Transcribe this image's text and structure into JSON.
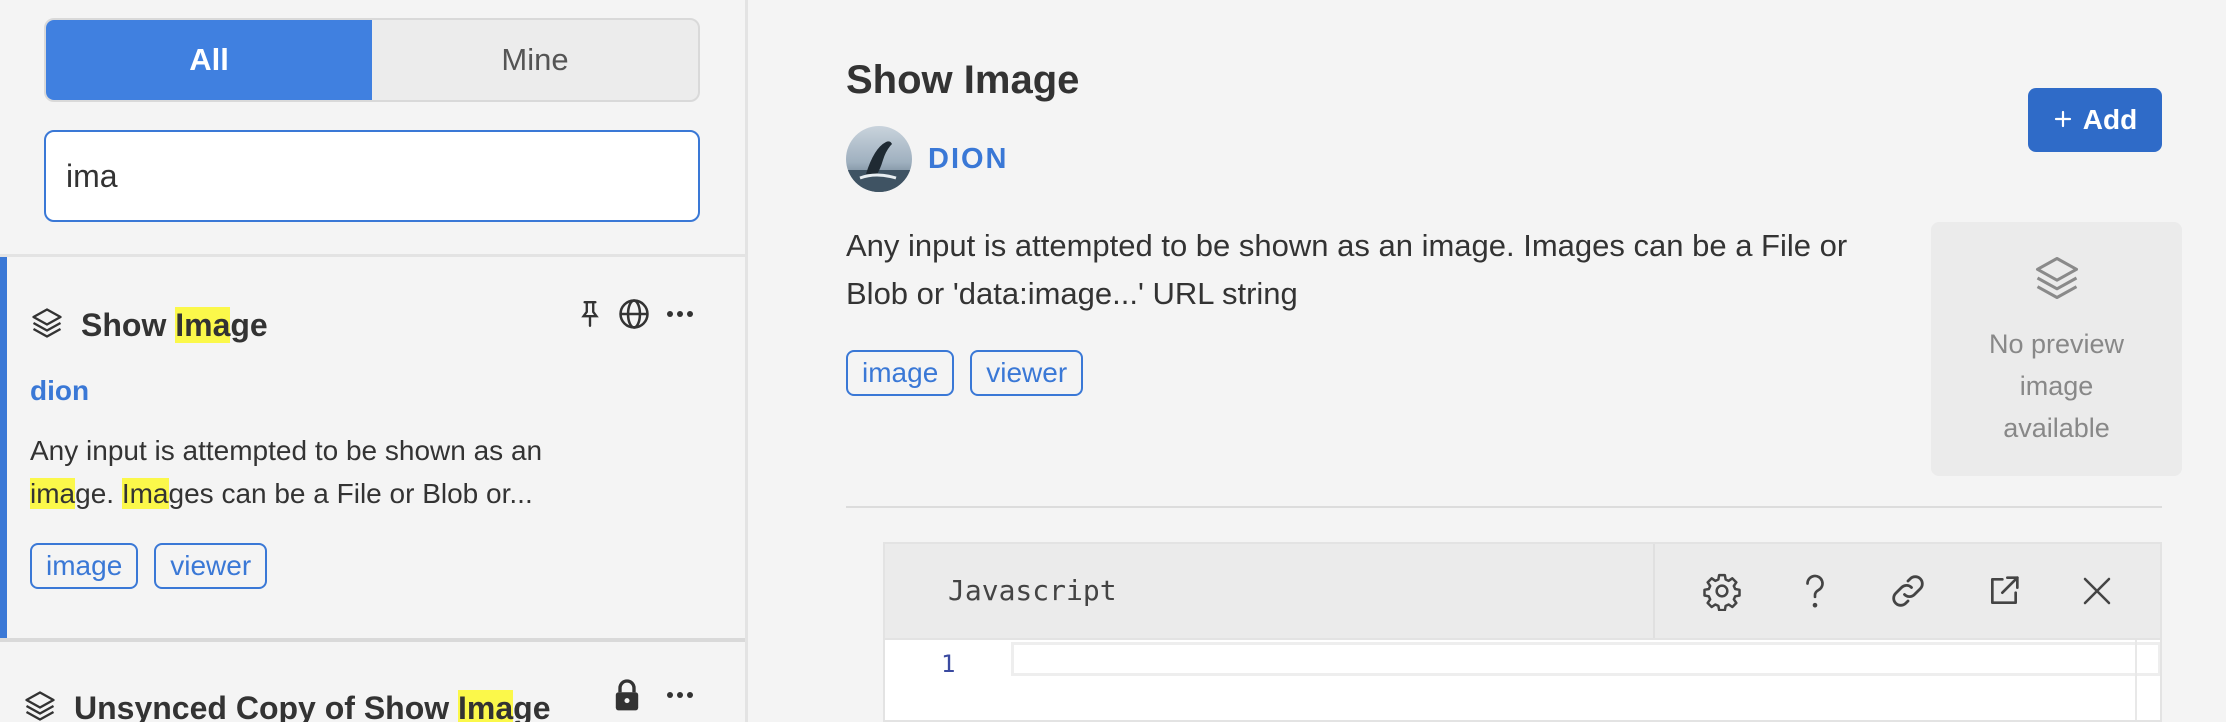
{
  "filter": {
    "tabs": [
      {
        "label": "All",
        "active": true
      },
      {
        "label": "Mine",
        "active": false
      }
    ],
    "search_value": "ima"
  },
  "results": [
    {
      "title_parts": [
        "Show ",
        "Ima",
        "ge"
      ],
      "author": "dion",
      "desc_parts": [
        "Any input is attempted to be shown as an ",
        "ima",
        "ge. ",
        "Ima",
        "ges can be a File or Blob or..."
      ],
      "tags": [
        "image",
        "viewer"
      ],
      "icons": [
        "pin-icon",
        "globe-icon",
        "more-icon"
      ]
    },
    {
      "title_parts": [
        "Unsynced Copy of Show ",
        "Ima",
        "ge"
      ],
      "icons": [
        "lock-icon",
        "more-icon"
      ]
    }
  ],
  "detail": {
    "title": "Show Image",
    "author": "DION",
    "add_label": "Add",
    "description": "Any input is attempted to be shown as an image. Images can be a File or Blob or 'data:image...' URL string",
    "tags": [
      "image",
      "viewer"
    ],
    "preview_text": "No preview image available"
  },
  "editor": {
    "language": "Javascript",
    "line_numbers": [
      "1"
    ],
    "toolbar_icons": [
      "gear-icon",
      "help-icon",
      "link-icon",
      "external-link-icon",
      "close-icon"
    ]
  },
  "colors": {
    "accent": "#3a78d6",
    "highlight": "#fbf84a",
    "add_button": "#2f6bc8"
  }
}
